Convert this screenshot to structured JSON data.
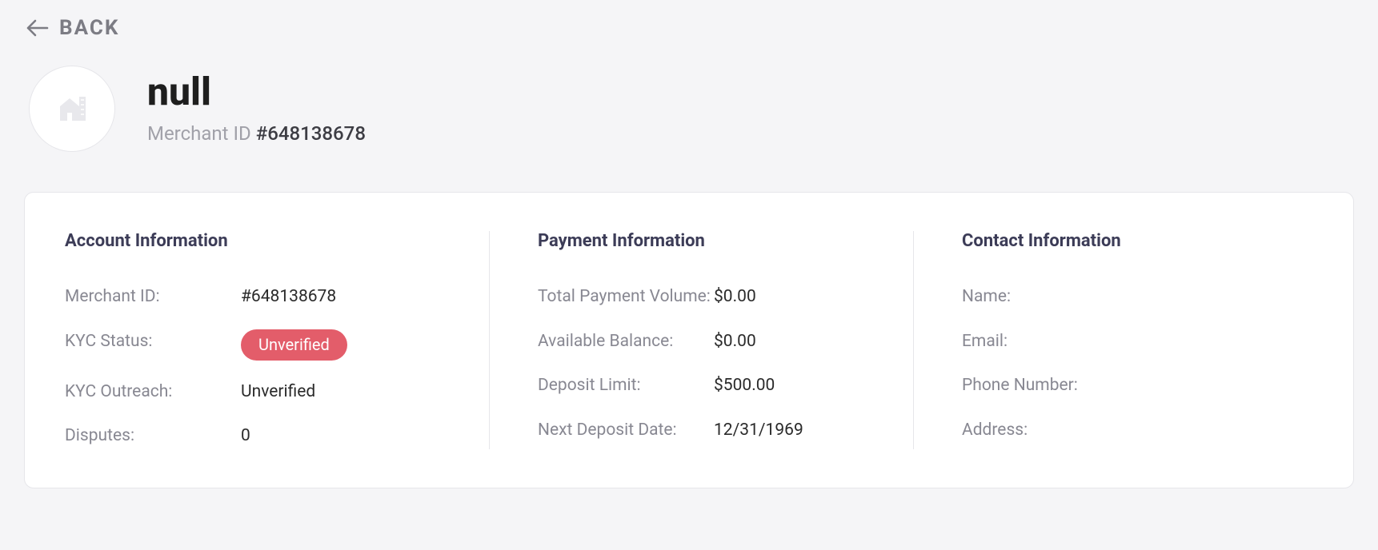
{
  "back": {
    "label": "BACK"
  },
  "header": {
    "title": "null",
    "id_label": "Merchant ID",
    "id_value": "#648138678"
  },
  "sections": {
    "account": {
      "title": "Account Information",
      "merchant_id": {
        "label": "Merchant ID:",
        "value": "#648138678"
      },
      "kyc_status": {
        "label": "KYC Status:",
        "value": "Unverified"
      },
      "kyc_outreach": {
        "label": "KYC Outreach:",
        "value": "Unverified"
      },
      "disputes": {
        "label": "Disputes:",
        "value": "0"
      }
    },
    "payment": {
      "title": "Payment Information",
      "total_volume": {
        "label": "Total Payment Volume:",
        "value": "$0.00"
      },
      "available_balance": {
        "label": "Available Balance:",
        "value": "$0.00"
      },
      "deposit_limit": {
        "label": "Deposit Limit:",
        "value": "$500.00"
      },
      "next_deposit": {
        "label": "Next Deposit Date:",
        "value": "12/31/1969"
      }
    },
    "contact": {
      "title": "Contact Information",
      "name": {
        "label": "Name:",
        "value": ""
      },
      "email": {
        "label": "Email:",
        "value": ""
      },
      "phone": {
        "label": "Phone Number:",
        "value": ""
      },
      "address": {
        "label": "Address:",
        "value": ""
      }
    }
  },
  "colors": {
    "status_pill_bg": "#e35d6a"
  }
}
